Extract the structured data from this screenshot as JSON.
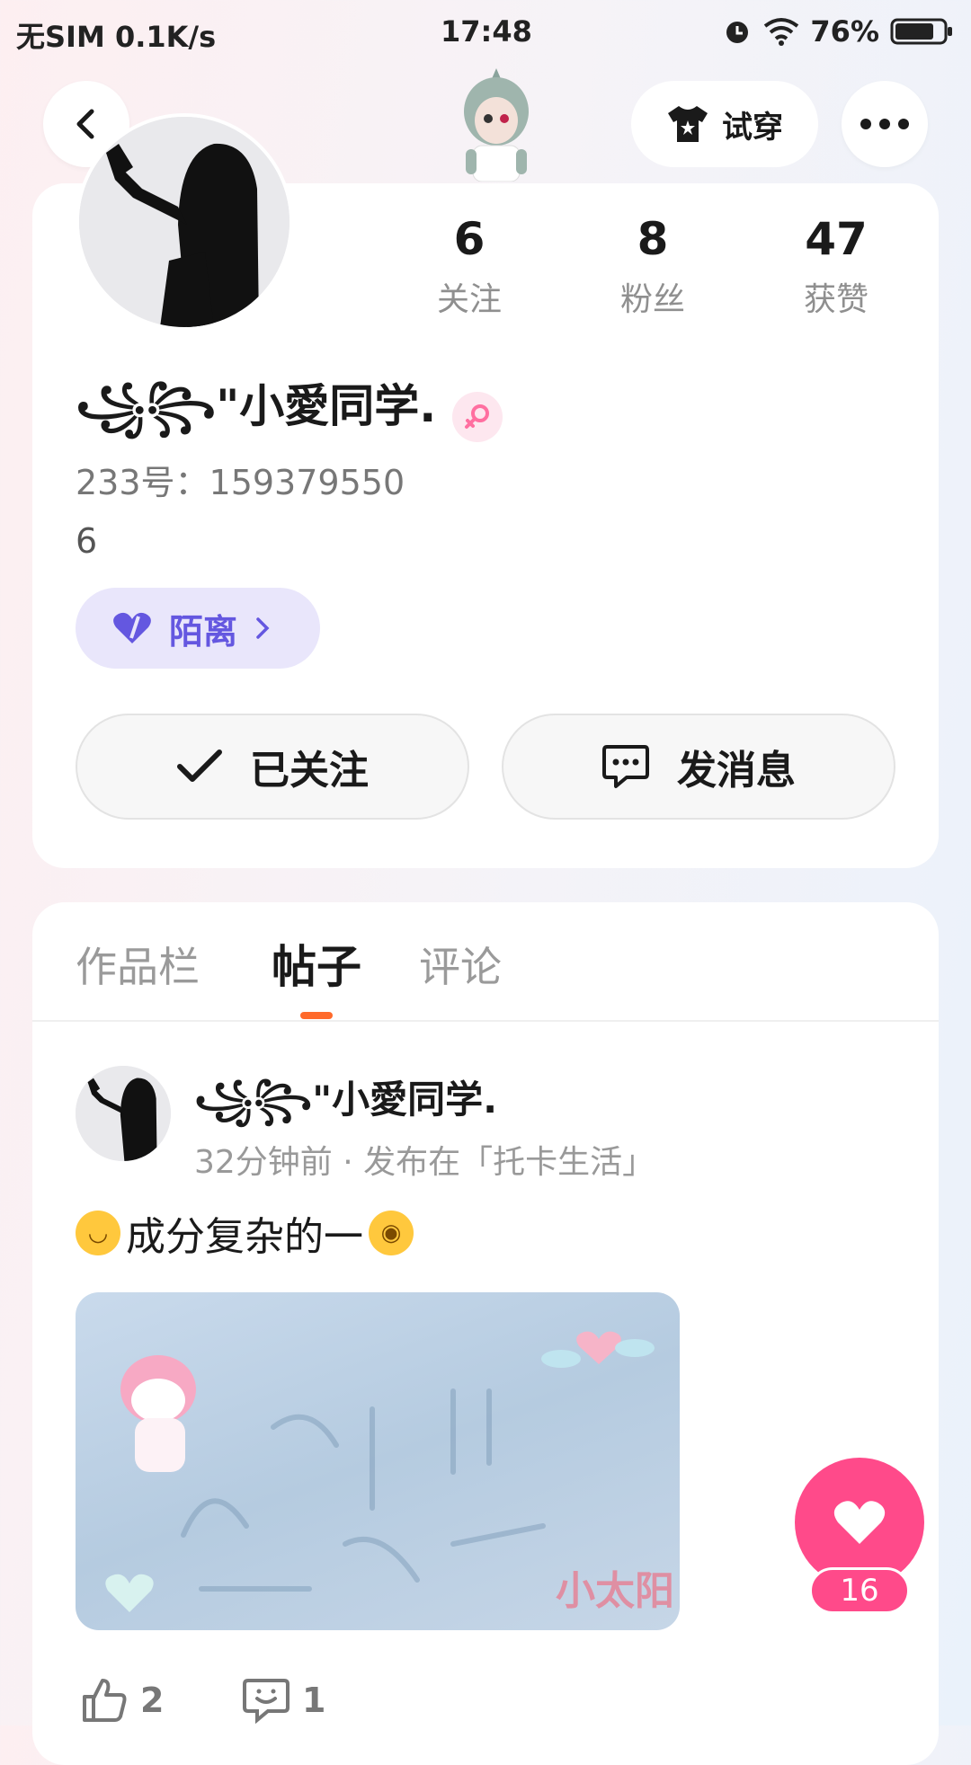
{
  "status_bar": {
    "carrier": "无SIM 0.1K/s",
    "time": "17:48",
    "battery": "76%"
  },
  "top_bar": {
    "tryon_label": "试穿"
  },
  "profile": {
    "nickname": "꧁꧂\"小愛同学.",
    "user_id": "233号：159379550",
    "bio": "6",
    "tag": "陌离",
    "stats": [
      {
        "num": "6",
        "label": "关注"
      },
      {
        "num": "8",
        "label": "粉丝"
      },
      {
        "num": "47",
        "label": "获赞"
      }
    ],
    "followed_label": "已关注",
    "message_label": "发消息"
  },
  "tabs": {
    "works": "作品栏",
    "posts": "帖子",
    "comments": "评论"
  },
  "post": {
    "author": "꧁꧂\"小愛同学.",
    "meta": "32分钟前 · 发布在「托卡生活」",
    "text": "成分复杂的一",
    "image_watermark": "小太阳",
    "like_count": "2",
    "comment_count": "1"
  },
  "floating": {
    "like_count": "16"
  },
  "colors": {
    "accent_orange": "#ff6a2b",
    "like_pink": "#ff4a8a",
    "tag_purple": "#6457e0"
  }
}
